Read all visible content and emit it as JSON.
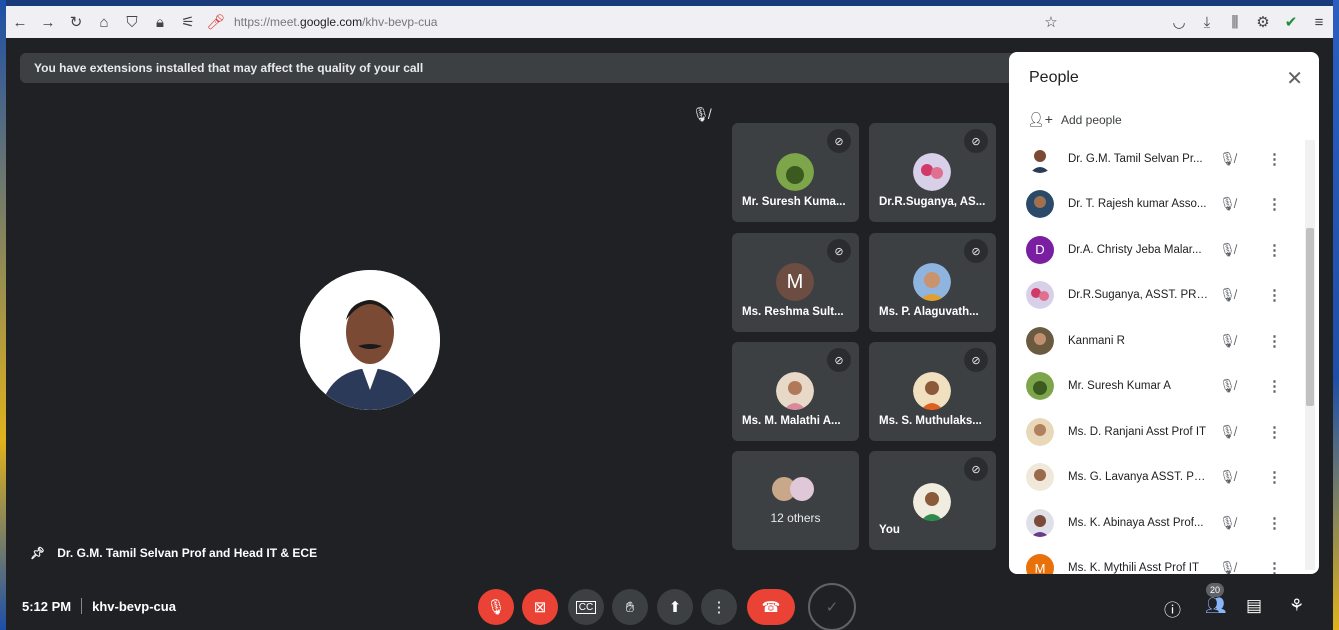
{
  "browser": {
    "url_prefix": "https://meet.",
    "url_domain": "google.com",
    "url_path": "/khv-bevp-cua"
  },
  "banner": {
    "text": "You have extensions installed that may affect the quality of your call"
  },
  "tiles": [
    {
      "name": "Mr. Suresh Kuma...",
      "avatar": "photo"
    },
    {
      "name": "Dr.R.Suganya, AS...",
      "avatar": "photo"
    },
    {
      "name": "Ms. Reshma Sult...",
      "avatar": "letter",
      "letter": "M"
    },
    {
      "name": "Ms. P. Alaguvath...",
      "avatar": "photo"
    },
    {
      "name": "Ms. M. Malathi A...",
      "avatar": "photo"
    },
    {
      "name": "Ms. S. Muthulaks...",
      "avatar": "photo"
    },
    {
      "others": "12 others"
    },
    {
      "name": "You",
      "avatar": "photo"
    }
  ],
  "pinned": {
    "name": "Dr. G.M. Tamil Selvan Prof and Head IT & ECE"
  },
  "bottom": {
    "time": "5:12 PM",
    "meeting_code": "khv-bevp-cua",
    "people_count": "20"
  },
  "people_panel": {
    "title": "People",
    "add_people": "Add people",
    "participants": [
      {
        "name": "Dr. G.M. Tamil Selvan Pr...",
        "avatar": "photo"
      },
      {
        "name": "Dr. T. Rajesh kumar Asso...",
        "avatar": "photo"
      },
      {
        "name": "Dr.A. Christy Jeba Malar...",
        "avatar": "letter",
        "letter": "D"
      },
      {
        "name": "Dr.R.Suganya, ASST. PROF",
        "avatar": "photo"
      },
      {
        "name": "Kanmani R",
        "avatar": "photo"
      },
      {
        "name": "Mr. Suresh Kumar A",
        "avatar": "photo"
      },
      {
        "name": "Ms. D. Ranjani Asst Prof IT",
        "avatar": "photo"
      },
      {
        "name": "Ms. G. Lavanya ASST. PR...",
        "avatar": "photo"
      },
      {
        "name": "Ms. K. Abinaya Asst Prof...",
        "avatar": "photo"
      },
      {
        "name": "Ms. K. Mythili Asst Prof IT",
        "avatar": "letter",
        "letter": "M"
      }
    ]
  }
}
